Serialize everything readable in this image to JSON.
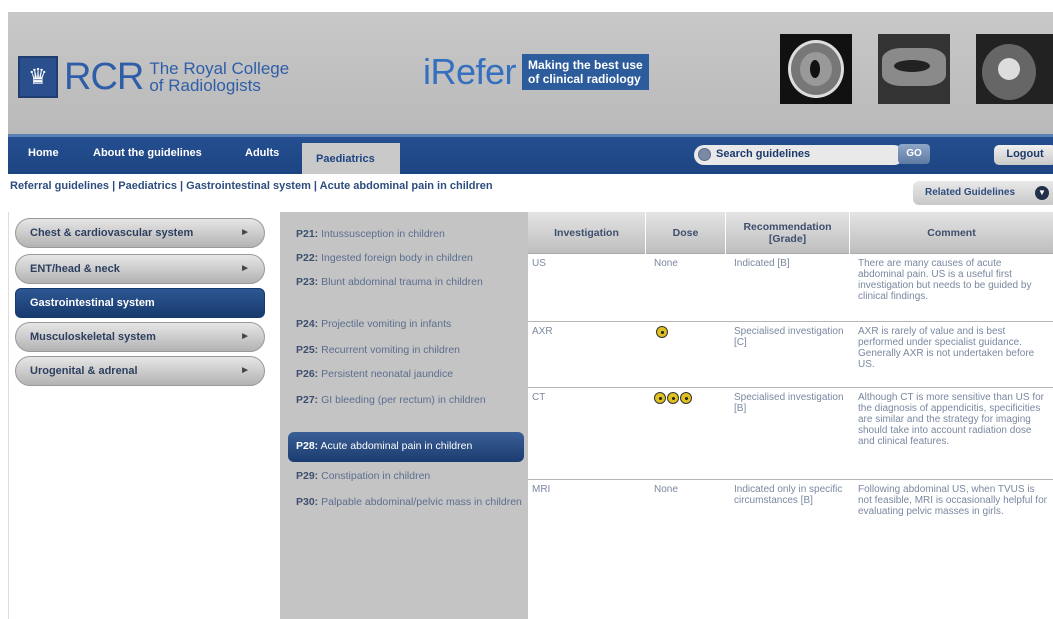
{
  "header": {
    "rcr_abbr": "RCR",
    "rcr_name_line1": "The Royal College",
    "rcr_name_line2": "of Radiologists",
    "irefer_word": "iRefer",
    "irefer_tag_line1": "Making the best use",
    "irefer_tag_line2": "of clinical radiology"
  },
  "nav": {
    "items": [
      "Home",
      "About the guidelines",
      "Adults",
      "Paediatrics"
    ],
    "search_placeholder": "Search guidelines",
    "go_label": "GO",
    "logout_label": "Logout"
  },
  "breadcrumb": {
    "parts": [
      "Referral guidelines",
      "Paediatrics",
      "Gastrointestinal system",
      "Acute abdominal pain in children"
    ],
    "separator": " | "
  },
  "related_label": "Related Guidelines",
  "sidebar": {
    "items": [
      {
        "label": "Chest & cardiovascular system"
      },
      {
        "label": "ENT/head & neck"
      },
      {
        "label": "Gastrointestinal system"
      },
      {
        "label": "Musculoskeletal system"
      },
      {
        "label": "Urogenital & adrenal"
      }
    ],
    "active": "Gastrointestinal system"
  },
  "topics": [
    {
      "code": "P21:",
      "text": "Intussusception in children"
    },
    {
      "code": "P22:",
      "text": "Ingested foreign body in children"
    },
    {
      "code": "P23:",
      "text": "Blunt abdominal trauma in children"
    },
    {
      "code": "P24:",
      "text": "Projectile vomiting in infants"
    },
    {
      "code": "P25:",
      "text": "Recurrent vomiting in children"
    },
    {
      "code": "P26:",
      "text": "Persistent neonatal jaundice"
    },
    {
      "code": "P27:",
      "text": "GI bleeding (per rectum) in children"
    },
    {
      "code": "P28:",
      "text": "Acute abdominal pain in children"
    },
    {
      "code": "P29:",
      "text": "Constipation in children"
    },
    {
      "code": "P30:",
      "text": "Palpable abdominal/pelvic mass in children"
    }
  ],
  "active_topic": "P28:",
  "table": {
    "headers": [
      "Investigation",
      "Dose",
      "Recommendation [Grade]",
      "Comment"
    ],
    "rows": [
      {
        "investigation": "US",
        "dose": "None",
        "dose_icons": 0,
        "recommendation": "Indicated [B]",
        "comment": "There are many causes of acute abdominal pain. US is a useful first investigation but needs to be guided by clinical findings."
      },
      {
        "investigation": "AXR",
        "dose": "",
        "dose_icons": 1,
        "recommendation": "Specialised investigation [C]",
        "comment": "AXR is rarely of value and is best performed under specialist guidance. Generally AXR is not undertaken before US."
      },
      {
        "investigation": "CT",
        "dose": "",
        "dose_icons": 3,
        "recommendation": "Specialised investigation [B]",
        "comment": "Although CT is more sensitive than US for the diagnosis of appendicitis, specificities are similar and the strategy for imaging should take into account radiation dose and clinical features."
      },
      {
        "investigation": "MRI",
        "dose": "None",
        "dose_icons": 0,
        "recommendation": "Indicated only in specific circumstances [B]",
        "comment": "Following abdominal US, when TVUS is not feasible, MRI is occasionally helpful for evaluating pelvic masses in girls."
      }
    ]
  },
  "colors": {
    "nav_blue": "#1d4482",
    "active_blue": "#173a6e",
    "radiation_yellow": "#e0c020"
  },
  "icons": [
    "crest-icon",
    "search-icon",
    "chevron-down-icon",
    "arrow-right-icon",
    "radiation-icon"
  ]
}
